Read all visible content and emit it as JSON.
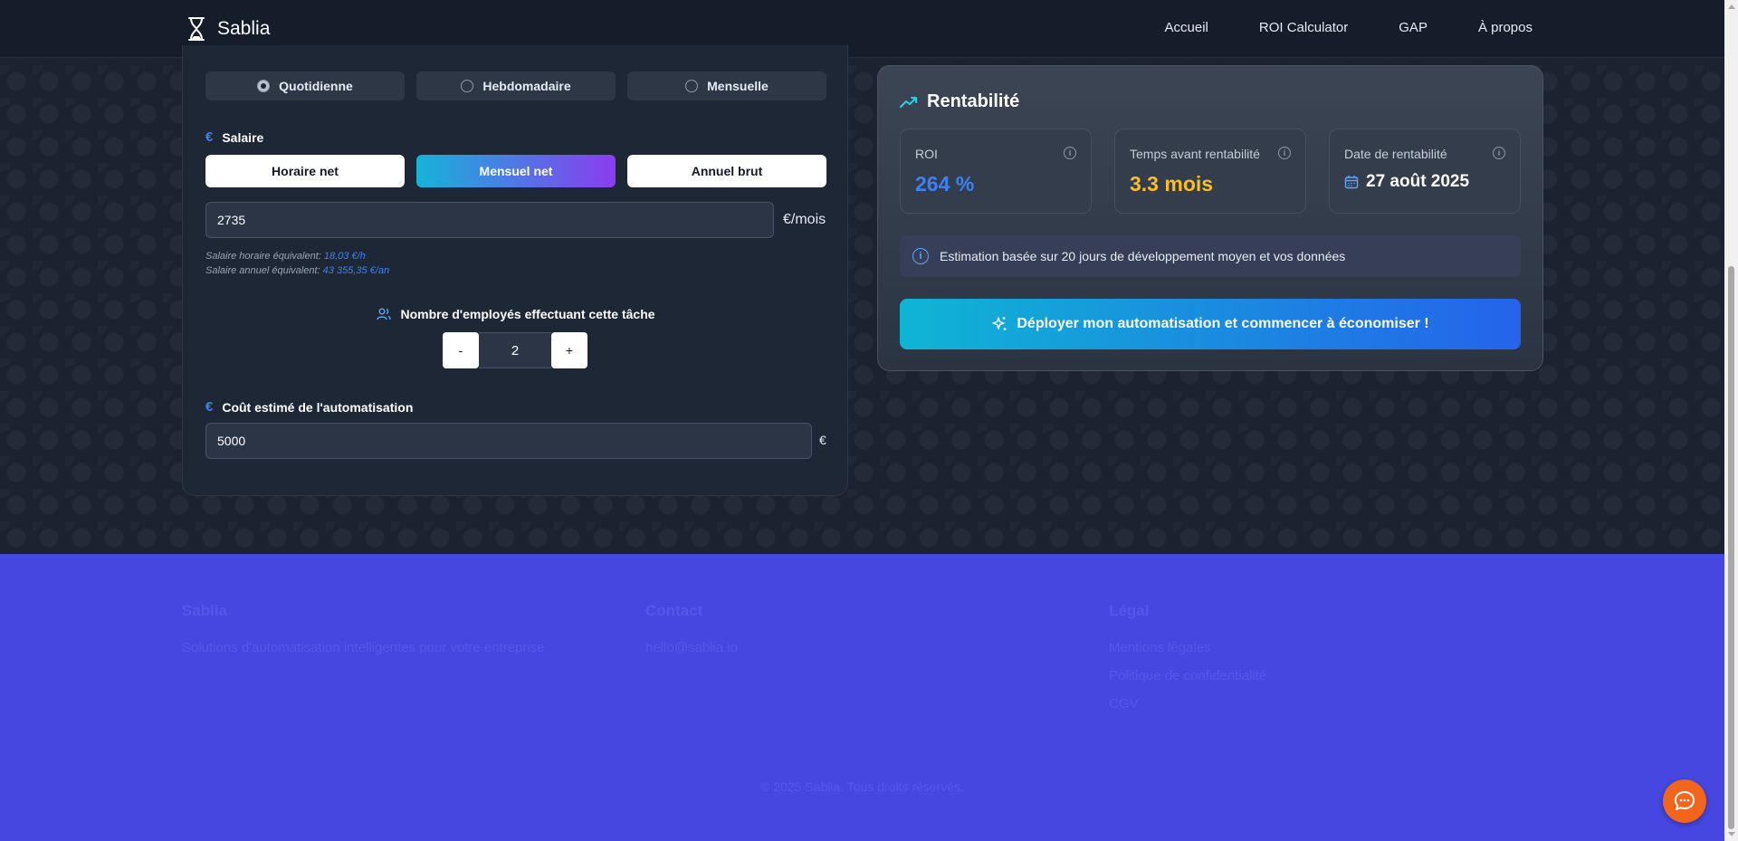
{
  "header": {
    "brand": "Sablia",
    "nav": [
      "Accueil",
      "ROI Calculator",
      "GAP",
      "À propos"
    ]
  },
  "frequency": {
    "options": [
      "Quotidienne",
      "Hebdomadaire",
      "Mensuelle"
    ],
    "selected": "Quotidienne"
  },
  "salary": {
    "label": "Salaire",
    "euro_symbol": "€",
    "modes": [
      "Horaire net",
      "Mensuel net",
      "Annuel brut"
    ],
    "active_mode": "Mensuel net",
    "value": "2735",
    "unit": "€/mois",
    "hourly_label": "Salaire horaire équivalent:",
    "hourly_value": "18,03 €/h",
    "annual_label": "Salaire annuel équivalent:",
    "annual_value": "43 355,35 €/an"
  },
  "employees": {
    "label": "Nombre d'employés effectuant cette tâche",
    "minus": "-",
    "value": "2",
    "plus": "+"
  },
  "automation_cost": {
    "label": "Coût estimé de l'automatisation",
    "euro_symbol": "€",
    "value": "5000",
    "unit": "€"
  },
  "results": {
    "title": "Rentabilité",
    "roi_label": "ROI",
    "roi_value": "264 %",
    "time_label": "Temps avant rentabilité",
    "time_value": "3.3 mois",
    "date_label": "Date de rentabilité",
    "date_value": "27 août 2025",
    "info_symbol": "i",
    "info_text": "Estimation basée sur 20 jours de développement moyen et vos données",
    "cta_label": "Déployer mon automatisation et commencer à économiser !"
  },
  "footer": {
    "col1_title": "Sablia",
    "col1_text": "Solutions d'automatisation intelligentes pour votre entreprise",
    "col2_title": "Contact",
    "col2_text": "hello@sablia.io",
    "col3_title": "Légal",
    "col3_items": [
      "Mentions légales",
      "Politique de confidentialité",
      "CGV"
    ],
    "copyright": "© 2025 Sablia. Tous droits réservés."
  },
  "colors": {
    "accent_blue": "#3b82f6",
    "roi_value": "#3b82f6",
    "time_value": "#fbbf24",
    "footer_bg": "#4547e0",
    "chat_button": "#f2651c"
  }
}
